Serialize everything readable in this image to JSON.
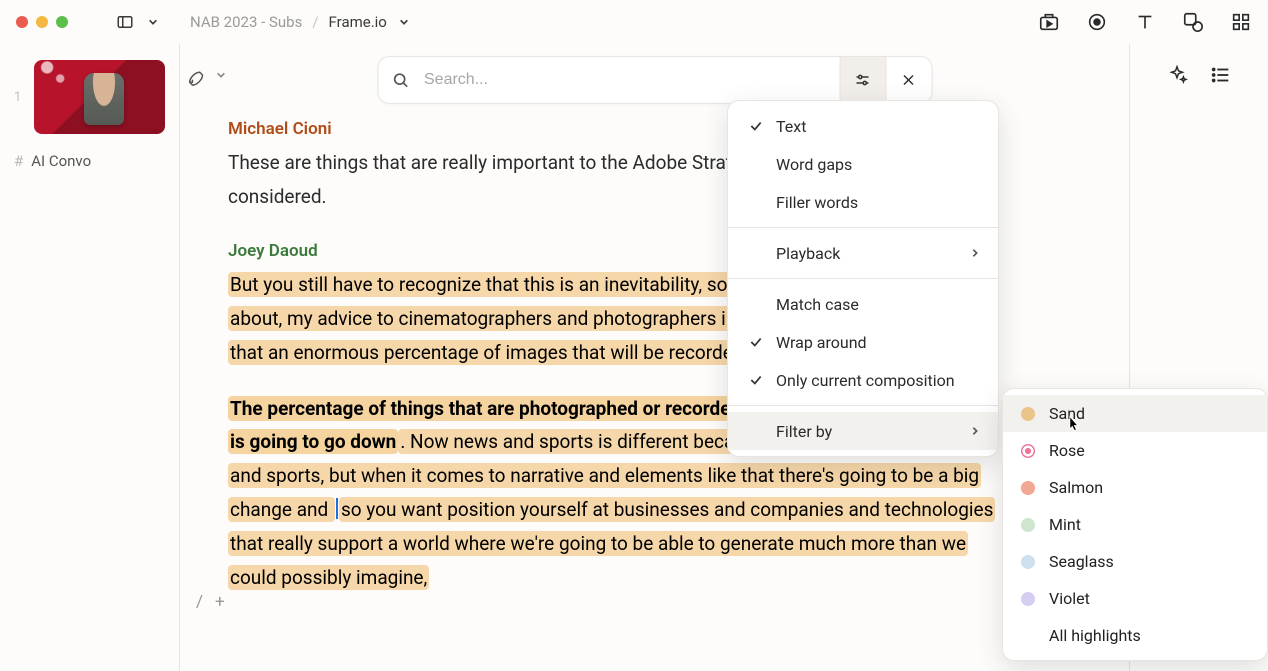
{
  "breadcrumb": {
    "parent": "NAB 2023 - Subs",
    "current": "Frame.io"
  },
  "sidebar": {
    "index": "1",
    "clip_label": "AI Convo"
  },
  "search": {
    "placeholder": "Search..."
  },
  "doc": {
    "sp1_name": "Michael Cioni",
    "sp1_text": "These are things that are really important to the Adobe Strategy is that those things are considered.",
    "sp2_name": "Joey Daoud",
    "sp2_hl1": "But you still have to recognize that this is an inevitability, so any business has to think about, my advice to cinematographers and photographers in general, is to really recognize that an enormous percentage of images that will be recorded is going to go down.",
    "sp2_bold": "The percentage of things that are photographed or recorded in the world for productions is going to go down",
    "sp2_rest_a": ". Now news and sports is different because you can't generate news and sports, but when it comes to narrative and elements like that there's going to be a big change and ",
    "sp2_rest_b": "so you want position yourself at businesses and companies and technologies that really support a world where we're going to be able to generate much more than we could possibly imagine,"
  },
  "menu": {
    "text": "Text",
    "word_gaps": "Word gaps",
    "filler": "Filler words",
    "playback": "Playback",
    "match_case": "Match case",
    "wrap": "Wrap around",
    "only_current": "Only current composition",
    "filter_by": "Filter by",
    "checked": {
      "text": true,
      "wrap": true,
      "only_current": true
    }
  },
  "filter_colors": {
    "sand": "Sand",
    "rose": "Rose",
    "salmon": "Salmon",
    "mint": "Mint",
    "seaglass": "Seaglass",
    "violet": "Violet",
    "all": "All highlights"
  },
  "gutter": {
    "slash": "/",
    "plus": "+"
  }
}
